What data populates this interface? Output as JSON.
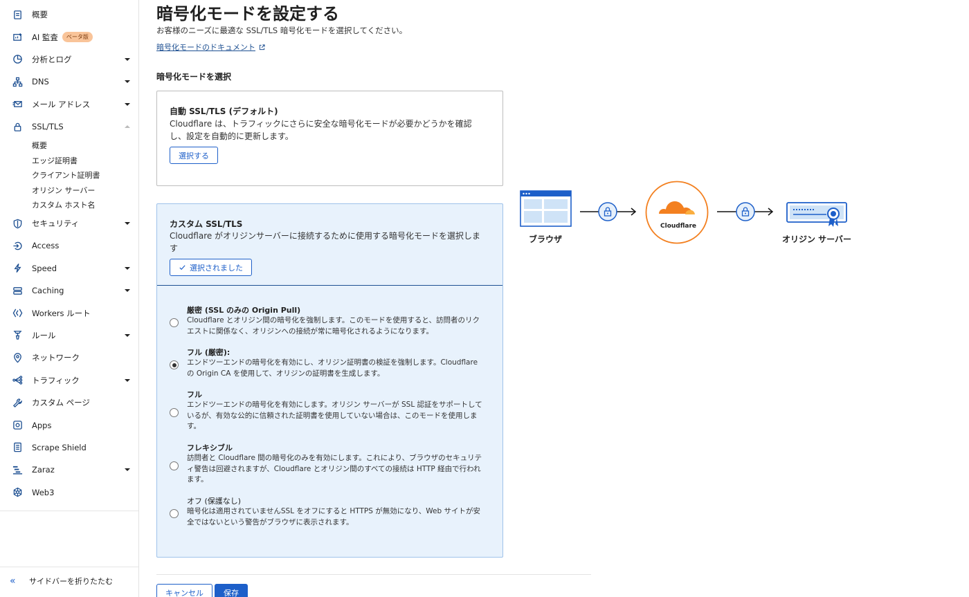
{
  "sidebar": {
    "items": [
      {
        "label": "概要",
        "icon": "document-icon",
        "caret": false
      },
      {
        "label": "AI 監査",
        "icon": "ai-audit-icon",
        "badge": "ベータ版",
        "caret": false
      },
      {
        "label": "分析とログ",
        "icon": "analytics-icon",
        "caret": true
      },
      {
        "label": "DNS",
        "icon": "dns-icon",
        "caret": true
      },
      {
        "label": "メール アドレス",
        "icon": "email-icon",
        "caret": true
      },
      {
        "label": "SSL/TLS",
        "icon": "lock-icon",
        "caret": "up"
      },
      {
        "label": "セキュリティ",
        "icon": "shield-icon",
        "caret": true
      },
      {
        "label": "Access",
        "icon": "access-icon",
        "caret": false
      },
      {
        "label": "Speed",
        "icon": "lightning-icon",
        "caret": true
      },
      {
        "label": "Caching",
        "icon": "caching-icon",
        "caret": true
      },
      {
        "label": "Workers ルート",
        "icon": "workers-icon",
        "caret": false
      },
      {
        "label": "ルール",
        "icon": "rules-icon",
        "caret": true
      },
      {
        "label": "ネットワーク",
        "icon": "location-pin-icon",
        "caret": false
      },
      {
        "label": "トラフィック",
        "icon": "traffic-icon",
        "caret": true
      },
      {
        "label": "カスタム ページ",
        "icon": "wrench-icon",
        "caret": false
      },
      {
        "label": "Apps",
        "icon": "apps-icon",
        "caret": false
      },
      {
        "label": "Scrape Shield",
        "icon": "scrape-shield-icon",
        "caret": false
      },
      {
        "label": "Zaraz",
        "icon": "zaraz-icon",
        "caret": true
      },
      {
        "label": "Web3",
        "icon": "web3-icon",
        "caret": false
      }
    ],
    "ssl_subitems": [
      "概要",
      "エッジ証明書",
      "クライアント証明書",
      "オリジン サーバー",
      "カスタム ホスト名"
    ],
    "collapse_label": "サイドバーを折りたたむ"
  },
  "main": {
    "title": "暗号化モードを設定する",
    "description": "お客様のニーズに最適な SSL/TLS 暗号化モードを選択してください。",
    "doc_link": "暗号化モードのドキュメント",
    "section_label": "暗号化モードを選択",
    "auto_card": {
      "title": "自動 SSL/TLS (デフォルト)",
      "description": "Cloudflare は、トラフィックにさらに安全な暗号化モードが必要かどうかを確認し、設定を自動的に更新します。",
      "button": "選択する"
    },
    "custom_card": {
      "title": "カスタム SSL/TLS",
      "description": "Cloudflare がオリジンサーバーに接続するために使用する暗号化モードを選択します",
      "button": "選択されました",
      "selected_option": 1,
      "options": [
        {
          "title": "厳密 (SSL のみの Origin Pull)",
          "description": "Cloudflare とオリジン間の暗号化を強制します。このモードを使用すると、訪問者のリクエストに関係なく、オリジンへの接続が常に暗号化されるようになります。"
        },
        {
          "title": "フル (厳密):",
          "description": "エンドツーエンドの暗号化を有効にし、オリジン証明書の検証を強制します。Cloudflare の Origin CA を使用して、オリジンの証明書を生成します。"
        },
        {
          "title": "フル",
          "description": "エンドツーエンドの暗号化を有効にします。オリジン サーバーが SSL 認証をサポートしているが、有効な公的に信頼された証明書を使用していない場合は、このモードを使用します。"
        },
        {
          "title": "フレキシブル",
          "description": "訪問者と Cloudflare 間の暗号化のみを有効にします。これにより、ブラウザのセキュリティ警告は回避されますが、Cloudflare とオリジン間のすべての接続は HTTP 経由で行われます。"
        },
        {
          "title": "オフ (保護なし)",
          "description": "暗号化は適用されていませんSSL をオフにすると HTTPS が無効になり、Web サイトが安全ではないという警告がブラウザに表示されます。"
        }
      ]
    },
    "cancel_button": "キャンセル",
    "save_button": "保存"
  },
  "diagram": {
    "browser_label": "ブラウザ",
    "cloudflare_label": "Cloudflare",
    "origin_label": "オリジン サーバー"
  },
  "colors": {
    "accent": "#1d5fc9",
    "nav_icon": "#1d4f91",
    "cloudflare_orange": "#f38020",
    "selected_card_bg": "#e8f2fc"
  }
}
